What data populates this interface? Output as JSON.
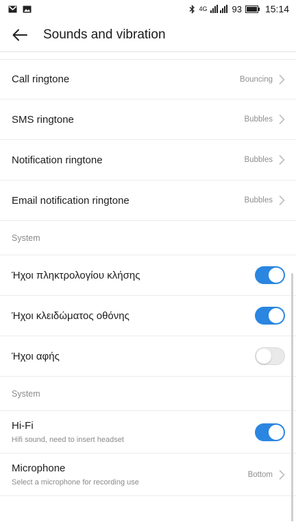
{
  "status_bar": {
    "network": "4G",
    "battery": "93",
    "time": "15:14",
    "icons": [
      "gmail-icon",
      "image-icon",
      "bluetooth-icon",
      "signal-icon",
      "battery-icon"
    ]
  },
  "header": {
    "title": "Sounds and vibration"
  },
  "ringtones": [
    {
      "label": "Call ringtone",
      "value": "Bouncing"
    },
    {
      "label": "SMS ringtone",
      "value": "Bubbles"
    },
    {
      "label": "Notification ringtone",
      "value": "Bubbles"
    },
    {
      "label": "Email notification ringtone",
      "value": "Bubbles"
    }
  ],
  "system_section": {
    "header": "System",
    "items": [
      {
        "label": "Ήχοι πληκτρολογίου κλήσης",
        "on": true
      },
      {
        "label": "Ήχοι κλειδώματος οθόνης",
        "on": true
      },
      {
        "label": "Ήχοι αφής",
        "on": false
      }
    ]
  },
  "audio_section": {
    "header": "System",
    "hifi": {
      "label": "Hi-Fi",
      "sub": "Hifi sound, need to insert headset",
      "on": true
    },
    "microphone": {
      "label": "Microphone",
      "sub": "Select a microphone for recording use",
      "value": "Bottom"
    }
  },
  "colors": {
    "accent": "#2a86e0",
    "toggle_off": "#e9e9e9",
    "divider": "#ececec"
  }
}
